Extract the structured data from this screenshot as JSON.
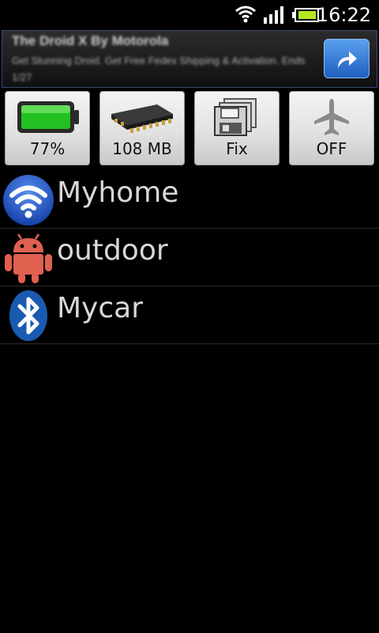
{
  "status_bar": {
    "time": "16:22",
    "icons": [
      "wifi-signal-icon",
      "cell-signal-icon",
      "battery-icon"
    ]
  },
  "ad": {
    "title": "The Droid X By Motorola",
    "description": "Get Stunning Droid. Get Free Fedex Shipping & Activation. Ends 1/27",
    "action_icon": "share-arrow-icon"
  },
  "toolbar": {
    "buttons": [
      {
        "label": "77%",
        "icon": "battery-icon"
      },
      {
        "label": "108 MB",
        "icon": "memory-chip-icon"
      },
      {
        "label": "Fix",
        "icon": "floppy-disk-icon"
      },
      {
        "label": "OFF",
        "icon": "airplane-icon"
      }
    ]
  },
  "profiles": [
    {
      "label": "Myhome",
      "icon": "wifi-icon"
    },
    {
      "label": "outdoor",
      "icon": "android-icon"
    },
    {
      "label": "Mycar",
      "icon": "bluetooth-icon"
    }
  ],
  "colors": {
    "background": "#000000",
    "battery_green": "#22c020",
    "android_red": "#e06050",
    "bluetooth_blue": "#1a5ab0",
    "wifi_blue": "#2058c8"
  }
}
